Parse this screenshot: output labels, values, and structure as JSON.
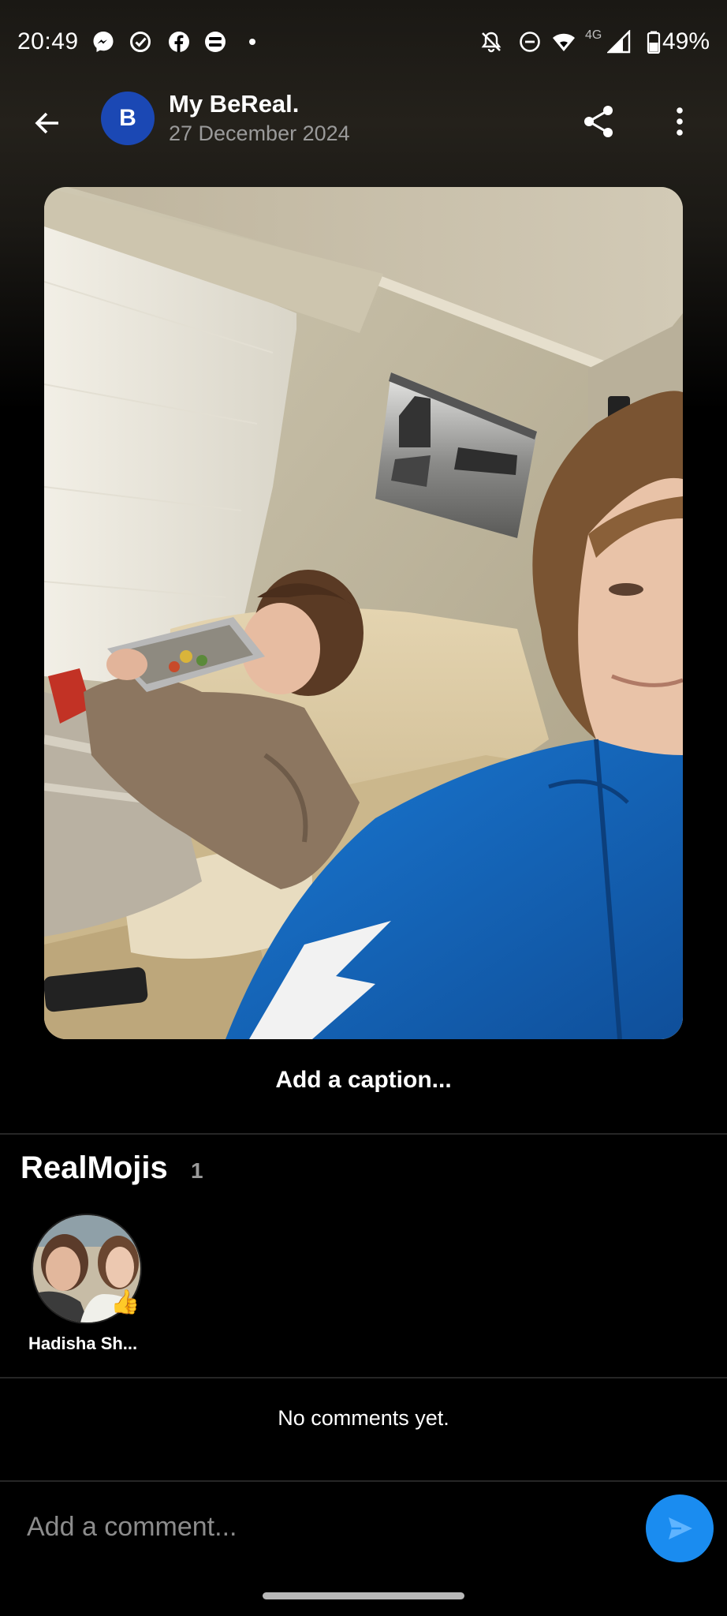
{
  "status_bar": {
    "time": "20:49",
    "battery": "49%",
    "network": "4G",
    "left_icons": [
      "messenger-icon",
      "check-circle-icon",
      "facebook-icon",
      "bereal-icon",
      "dot-icon"
    ],
    "right_icons": [
      "bell-off-icon",
      "do-not-disturb-icon",
      "wifi-icon",
      "signal-icon",
      "battery-icon"
    ]
  },
  "header": {
    "avatar_letter": "B",
    "title": "My BeReal.",
    "date": "27 December 2024"
  },
  "caption": {
    "label": "Add a caption..."
  },
  "realmojis": {
    "title": "RealMojis",
    "count": "1",
    "items": [
      {
        "name": "Hadisha Sh...",
        "emoji": "👍"
      }
    ]
  },
  "comments": {
    "empty_text": "No comments yet.",
    "input_placeholder": "Add a comment..."
  },
  "colors": {
    "background": "#000000",
    "avatar": "#1b48b4",
    "send_button": "#1a8cf0",
    "secondary_text": "#9a9a9a"
  }
}
